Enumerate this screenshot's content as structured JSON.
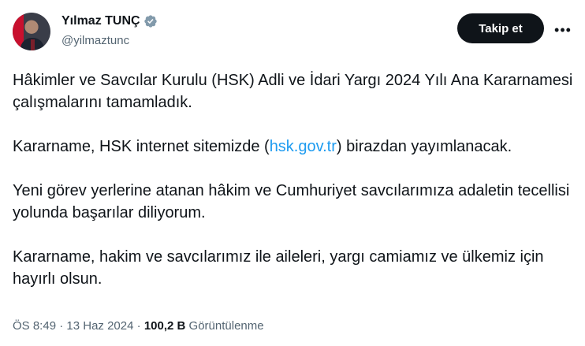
{
  "author": {
    "name": "Yılmaz TUNÇ",
    "handle": "@yilmaztunc"
  },
  "actions": {
    "follow_label": "Takip et",
    "more_label": "•••"
  },
  "tweet": {
    "p1": "Hâkimler ve Savcılar Kurulu (HSK) Adli ve İdari Yargı 2024 Yılı Ana Kararnamesi çalışmalarını tamamladık.",
    "p2_before": "Kararname, HSK internet sitemizde (",
    "p2_link": "hsk.gov.tr",
    "p2_after": ") birazdan yayımlanacak.",
    "p3": "Yeni görev yerlerine atanan hâkim ve Cumhuriyet savcılarımıza adaletin tecellisi yolunda başarılar diliyorum.",
    "p4": "Kararname, hakim ve savcılarımız ile aileleri, yargı camiamız ve ülkemiz için hayırlı olsun."
  },
  "meta": {
    "time": "ÖS 8:49",
    "sep": " · ",
    "date": "13 Haz 2024",
    "views_count": "100,2 B",
    "views_label": "Görüntülenme"
  },
  "colors": {
    "link": "#1d9bf0",
    "verified": "#829aab",
    "follow_bg": "#0f1419",
    "secondary_text": "#536471"
  },
  "icons": {
    "verified": "verified-badge-icon",
    "more": "more-horizontal-icon"
  }
}
